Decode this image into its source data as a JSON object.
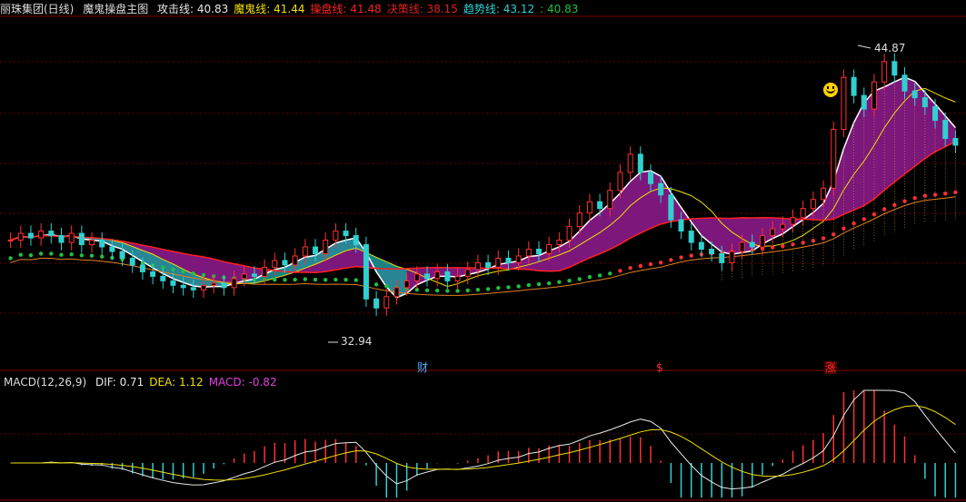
{
  "header": {
    "stock": "丽珠集团(日线)",
    "indicator": "魔鬼操盘主图",
    "items": [
      {
        "label": "攻击线:",
        "value": "40.83",
        "color": "#e8e8e8"
      },
      {
        "label": "魔鬼线:",
        "value": "41.44",
        "color": "#f0e000"
      },
      {
        "label": "操盘线:",
        "value": "41.48",
        "color": "#ff2020"
      },
      {
        "label": "决策线:",
        "value": "38.15",
        "color": "#e02020"
      },
      {
        "label": "趋势线:",
        "value": "43.12",
        "color": "#30d0d0"
      },
      {
        "label": ":",
        "value": "40.83",
        "color": "#20c040"
      }
    ]
  },
  "macd_header": {
    "name": "MACD(12,26,9)",
    "items": [
      {
        "label": "DIF:",
        "value": "0.71",
        "color": "#e8e8e8"
      },
      {
        "label": "DEA:",
        "value": "1.12",
        "color": "#f0e000"
      },
      {
        "label": "MACD:",
        "value": "-0.82",
        "color": "#e040e0"
      }
    ]
  },
  "annotations": {
    "high": "44.87",
    "low": "32.94",
    "markers": [
      {
        "text": "财",
        "color": "#4aa8ff"
      },
      {
        "text": "$",
        "color": "#ff3030"
      },
      {
        "text": "涨",
        "color": "#ff3030"
      }
    ]
  },
  "chart_data": {
    "type": "candlestick",
    "price_range": [
      31.0,
      46.5
    ],
    "closes": [
      36.6,
      36.9,
      36.7,
      37.0,
      36.8,
      36.5,
      36.9,
      36.4,
      36.6,
      36.3,
      36.1,
      35.8,
      35.5,
      35.2,
      35.0,
      34.8,
      34.6,
      34.5,
      34.4,
      34.6,
      34.7,
      34.5,
      34.9,
      35.1,
      35.0,
      35.4,
      35.7,
      35.5,
      35.9,
      36.3,
      36.0,
      36.6,
      37.0,
      36.8,
      36.4,
      34.0,
      33.6,
      34.1,
      34.5,
      34.8,
      35.1,
      34.9,
      35.2,
      34.8,
      35.0,
      35.3,
      35.6,
      35.4,
      35.8,
      35.6,
      35.9,
      36.2,
      36.0,
      36.4,
      36.6,
      37.2,
      37.8,
      38.3,
      38.0,
      38.8,
      39.6,
      40.4,
      39.6,
      39.1,
      38.6,
      37.5,
      37.0,
      36.5,
      36.2,
      36.0,
      35.6,
      36.1,
      36.5,
      36.3,
      36.8,
      37.1,
      37.3,
      37.6,
      38.0,
      38.4,
      38.9,
      41.5,
      43.8,
      43.0,
      42.4,
      43.6,
      44.5,
      43.9,
      43.2,
      42.9,
      42.5,
      41.9,
      41.1,
      40.8
    ]
  }
}
